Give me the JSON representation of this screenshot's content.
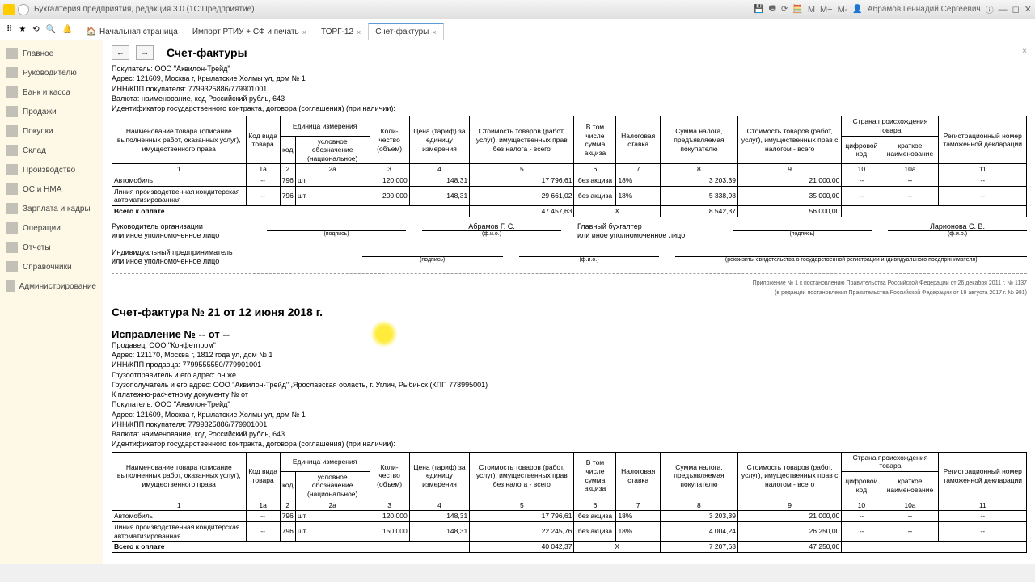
{
  "window": {
    "title": "Бухгалтерия предприятия, редакция 3.0  (1С:Предприятие)",
    "user": "Абрамов Геннадий Сергеевич"
  },
  "topbar_icons": [
    "☰",
    "★",
    "⟳",
    "🔔",
    "🔔"
  ],
  "tabs": {
    "home": "Начальная страница",
    "items": [
      {
        "label": "Импорт РТИУ + СФ и печать",
        "close": "×"
      },
      {
        "label": "ТОРГ-12",
        "close": "×"
      },
      {
        "label": "Счет-фактуры",
        "close": "×",
        "active": true
      }
    ]
  },
  "sidebar": [
    {
      "label": "Главное"
    },
    {
      "label": "Руководителю"
    },
    {
      "label": "Банк и касса"
    },
    {
      "label": "Продажи"
    },
    {
      "label": "Покупки"
    },
    {
      "label": "Склад"
    },
    {
      "label": "Производство"
    },
    {
      "label": "ОС и НМА"
    },
    {
      "label": "Зарплата и кадры"
    },
    {
      "label": "Операции"
    },
    {
      "label": "Отчеты"
    },
    {
      "label": "Справочники"
    },
    {
      "label": "Администрирование"
    }
  ],
  "page": {
    "title": "Счет-фактуры",
    "back": "←",
    "fwd": "→",
    "close": "×"
  },
  "doc1": {
    "hdr": [
      "Покупатель: ООО \"Аквилон-Трейд\"",
      "Адрес: 121609, Москва г, Крылатские Холмы ул, дом № 1",
      "ИНН/КПП покупателя: 7799325886/779901001",
      "Валюта: наименование, код Российский рубль, 643",
      "Идентификатор государственного контракта, договора (соглашения) (при наличии):"
    ],
    "cols": {
      "name": "Наименование товара (описание выполненных работ, оказанных услуг), имущественного права",
      "kind": "Код вида товара",
      "unit": "Единица измерения",
      "kod": "код",
      "usl": "условное обозначение (национальное)",
      "qty": "Коли-чество (объем)",
      "price": "Цена (тариф) за единицу измерения",
      "cost": "Стоимость товаров (работ, услуг), имущественных прав без налога - всего",
      "vtom": "В том числе сумма акциза",
      "rate": "Налоговая ставка",
      "tax": "Сумма налога, предъявляемая покупателю",
      "costall": "Стоимость товаров (работ, услуг), имущественных прав с налогом - всего",
      "country": "Страна происхождения товара",
      "dcode": "цифровой код",
      "dshort": "краткое наименование",
      "reg": "Регистрационный номер таможенной декларации"
    },
    "num": [
      "1",
      "1а",
      "2",
      "2а",
      "3",
      "4",
      "5",
      "6",
      "7",
      "8",
      "9",
      "10",
      "10а",
      "11"
    ],
    "rows": [
      {
        "name": "Автомобиль",
        "kind": "--",
        "kod": "796",
        "usl": "шт",
        "qty": "120,000",
        "price": "148,31",
        "cost": "17 796,61",
        "vtom": "без акциза",
        "rate": "18%",
        "tax": "3 203,39",
        "costall": "21 000,00",
        "dc": "--",
        "ds": "--",
        "reg": "--"
      },
      {
        "name": "Линия производственная кондитерская автоматизированная",
        "kind": "--",
        "kod": "796",
        "usl": "шт",
        "qty": "200,000",
        "price": "148,31",
        "cost": "29 661,02",
        "vtom": "без акциза",
        "rate": "18%",
        "tax": "5 338,98",
        "costall": "35 000,00",
        "dc": "--",
        "ds": "--",
        "reg": "--"
      }
    ],
    "total": {
      "label": "Всего к оплате",
      "cost": "47 457,63",
      "vtom": "X",
      "tax": "8 542,37",
      "costall": "56 000,00"
    },
    "sig": {
      "l1": "Руководитель организации",
      "l2": "или иное уполномоченное лицо",
      "p": "(подпись)",
      "f": "(ф.и.о.)",
      "name1": "Абрамов Г. С.",
      "gb": "Главный бухгалтер",
      "name2": "Ларионова С. В.",
      "ip1": "Индивидуальный предприниматель",
      "ip2": "или иное уполномоченное лицо",
      "rek": "(реквизиты свидетельства о государственной регистрации индивидуального предпринимателя)"
    },
    "foot1": "Приложение № 1 к постановлению Правительства Российской Федерации от 26 декабря 2011 г. № 1137",
    "foot2": "(в редакции постановления Правительства Российской Федерации от 19 августа 2017 г. № 981)"
  },
  "doc2": {
    "title": "Счет-фактура № 21 от 12 июня 2018 г.",
    "corr": "Исправление № -- от --",
    "hdr": [
      "Продавец: ООО \"Конфетпром\"",
      "Адрес: 121170, Москва г, 1812 года ул, дом № 1",
      "ИНН/КПП продавца: 7799555550/779901001",
      "Грузоотправитель и его адрес: он же",
      "Грузополучатель и его адрес: ООО \"Аквилон-Трейд\" ,Ярославская область, г. Углич, Рыбинск (КПП 778995001)",
      "К платежно-расчетному документу №     от",
      "Покупатель: ООО \"Аквилон-Трейд\"",
      "Адрес: 121609, Москва г, Крылатские Холмы ул, дом № 1",
      "ИНН/КПП покупателя: 7799325886/779901001",
      "Валюта: наименование, код Российский рубль, 643",
      "Идентификатор государственного контракта, договора (соглашения) (при наличии):"
    ],
    "rows": [
      {
        "name": "Автомобиль",
        "kind": "--",
        "kod": "796",
        "usl": "шт",
        "qty": "120,000",
        "price": "148,31",
        "cost": "17 796,61",
        "vtom": "без акциза",
        "rate": "18%",
        "tax": "3 203,39",
        "costall": "21 000,00",
        "dc": "--",
        "ds": "--",
        "reg": "--"
      },
      {
        "name": "Линия производственная кондитерская автоматизированная",
        "kind": "--",
        "kod": "796",
        "usl": "шт",
        "qty": "150,000",
        "price": "148,31",
        "cost": "22 245,76",
        "vtom": "без акциза",
        "rate": "18%",
        "tax": "4 004,24",
        "costall": "26 250,00",
        "dc": "--",
        "ds": "--",
        "reg": "--"
      }
    ],
    "total": {
      "label": "Всего к оплате",
      "cost": "40 042,37",
      "vtom": "X",
      "tax": "7 207,63",
      "costall": "47 250,00"
    }
  }
}
